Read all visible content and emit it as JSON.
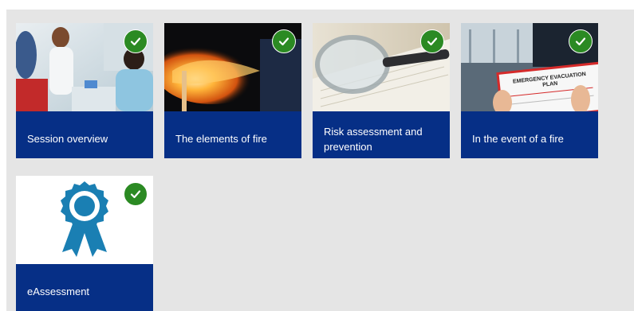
{
  "modules": [
    {
      "label": "Session overview",
      "completed": true,
      "image": "medical-staff-photo"
    },
    {
      "label": "The elements of fire",
      "completed": true,
      "image": "burning-match-photo"
    },
    {
      "label": "Risk assessment and prevention",
      "completed": true,
      "image": "magnifying-glass-photo"
    },
    {
      "label": "In the event of a fire",
      "completed": true,
      "image": "evacuation-plan-photo"
    },
    {
      "label": "eAssessment",
      "completed": true,
      "image": "award-ribbon-icon"
    }
  ],
  "evac_sign": {
    "line1": "EMERGENCY EVACUATION",
    "line2": "PLAN"
  },
  "colors": {
    "card_label_bg": "#062f86",
    "check_badge": "#2b8a23",
    "panel_bg": "#e5e5e5",
    "award_blue": "#1a7fb3"
  }
}
